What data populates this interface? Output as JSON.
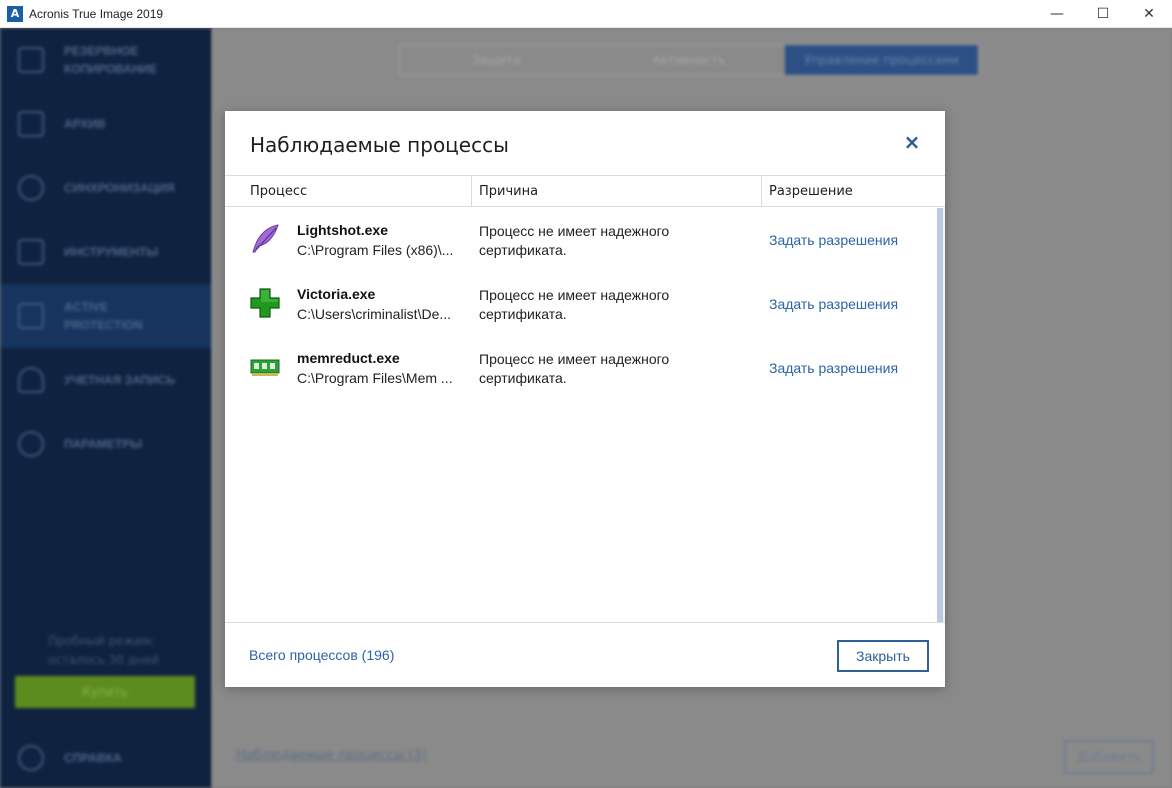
{
  "window": {
    "app_logo": "A",
    "title": "Acronis True Image 2019",
    "controls": {
      "minimize": "—",
      "maximize": "☐",
      "close": "✕"
    }
  },
  "sidebar": {
    "items": [
      {
        "label": "РЕЗЕРВНОЕ КОПИРОВАНИЕ",
        "icon": "backup-icon"
      },
      {
        "label": "АРХИВ",
        "icon": "archive-icon"
      },
      {
        "label": "СИНХРОНИЗАЦИЯ",
        "icon": "sync-icon"
      },
      {
        "label": "ИНСТРУМЕНТЫ",
        "icon": "tools-icon"
      },
      {
        "label": "ACTIVE PROTECTION",
        "icon": "shield-icon"
      },
      {
        "label": "УЧЕТНАЯ ЗАПИСЬ",
        "icon": "account-icon"
      },
      {
        "label": "ПАРАМЕТРЫ",
        "icon": "settings-icon"
      }
    ],
    "trial_text": "Пробный режим: осталось 30 дней",
    "buy_label": "Купить",
    "help_label": "СПРАВКА"
  },
  "main": {
    "tabs": [
      {
        "label": "Защита"
      },
      {
        "label": "Активность"
      },
      {
        "label": "Управление процессами"
      }
    ],
    "monitored_link": "Наблюдаемые процессы (3)",
    "add_label": "Добавить"
  },
  "dialog": {
    "title": "Наблюдаемые процессы",
    "close_icon": "×",
    "columns": {
      "process": "Процесс",
      "reason": "Причина",
      "permission": "Разрешение"
    },
    "rows": [
      {
        "name": "Lightshot.exe",
        "path": "C:\\Program Files (x86)\\...",
        "reason": "Процесс не имеет надежного сертификата.",
        "action": "Задать разрешения",
        "icon": "feather-icon"
      },
      {
        "name": "Victoria.exe",
        "path": "C:\\Users\\criminalist\\De...",
        "reason": "Процесс не имеет надежного сертификата.",
        "action": "Задать разрешения",
        "icon": "green-cross-icon"
      },
      {
        "name": "memreduct.exe",
        "path": "C:\\Program Files\\Mem ...",
        "reason": "Процесс не имеет надежного сертификата.",
        "action": "Задать разрешения",
        "icon": "memory-chip-icon"
      }
    ],
    "total_link": "Всего процессов (196)",
    "close_button": "Закрыть"
  },
  "colors": {
    "accent": "#2e63a7",
    "sidebar_bg": "#0f2240",
    "buy_green": "#5d8c1e"
  }
}
